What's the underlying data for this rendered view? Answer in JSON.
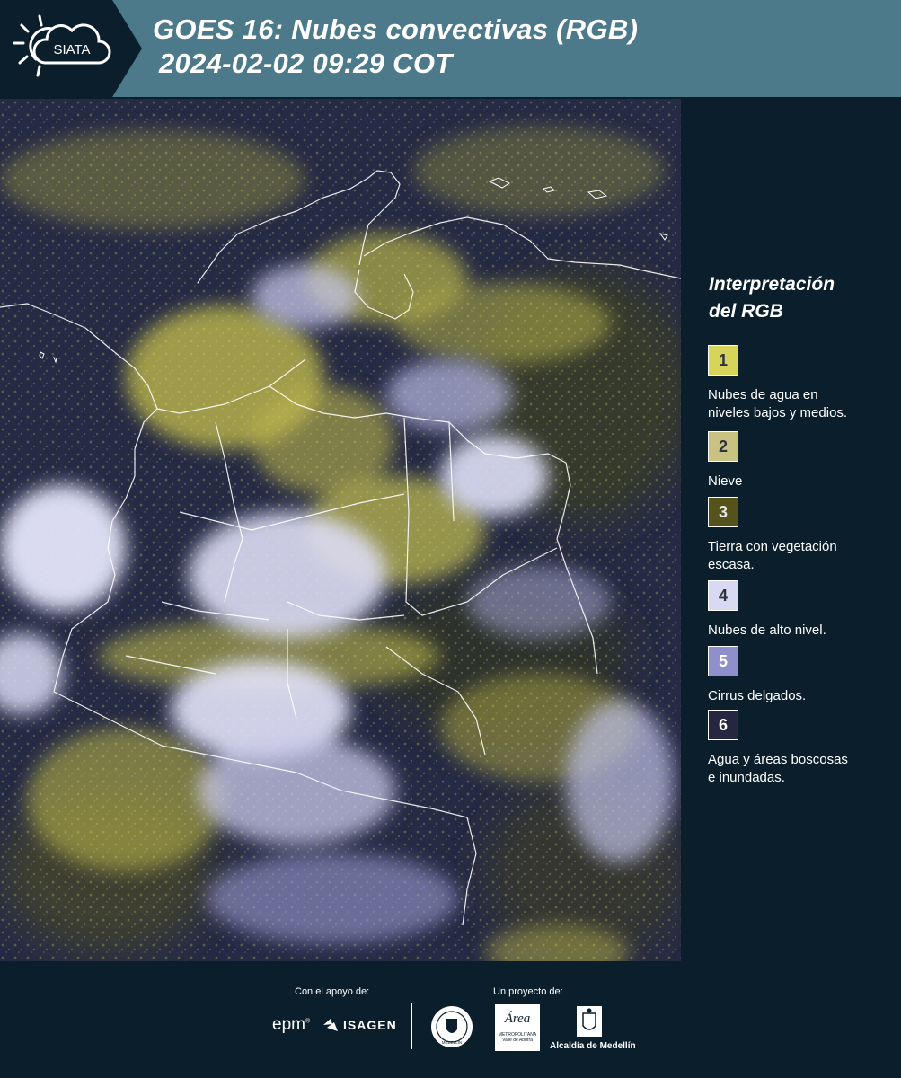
{
  "header": {
    "logo_text": "SIATA",
    "title_line1": "GOES 16: Nubes convectivas (RGB)",
    "title_line2": "2024-02-02 09:29 COT"
  },
  "legend": {
    "title_line1": "Interpretación",
    "title_line2": "del RGB",
    "items": [
      {
        "num": "1",
        "color": "#d7d45a",
        "label_lines": [
          "Nubes de agua en",
          "niveles bajos y medios."
        ]
      },
      {
        "num": "2",
        "color": "#c9c383",
        "label_lines": [
          "Nieve"
        ]
      },
      {
        "num": "3",
        "color": "#56521c",
        "label_lines": [
          "Tierra con vegetación",
          "escasa."
        ]
      },
      {
        "num": "4",
        "color": "#d8d9f2",
        "label_lines": [
          "Nubes de alto nivel."
        ]
      },
      {
        "num": "5",
        "color": "#8f90cb",
        "label_lines": [
          "Cirrus delgados."
        ]
      },
      {
        "num": "6",
        "color": "#252640",
        "label_lines": [
          "Agua y áreas boscosas",
          "e inundadas."
        ]
      }
    ]
  },
  "footer": {
    "support_caption": "Con el apoyo de:",
    "project_caption": "Un proyecto de:",
    "epm": "epm",
    "isagen": "ISAGEN",
    "area_line1": "Área",
    "area_line2": "METROPOLITANA",
    "area_line3": "Valle de Aburrá",
    "alcaldia": "Alcaldía de Medellín",
    "medellin_seal": "MEDELLÍN"
  }
}
